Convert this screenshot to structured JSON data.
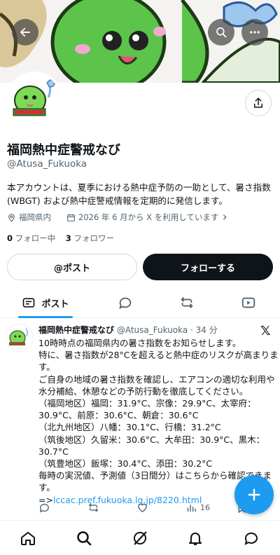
{
  "profile": {
    "name": "福岡熱中症警戒なび",
    "handle": "@Atusa_Fukuoka",
    "bio_line1": "本アカウントは、夏季における熱中症予防の一助として、暑さ指数",
    "bio_line2": "(WBGT) および熱中症警戒情報を定期的に発信します。",
    "location": "福岡県内",
    "joined": "2026 年 6 月から X を利用しています",
    "following_count": "0",
    "following_label": "フォロー中",
    "followers_count": "3",
    "followers_label": "フォロワー"
  },
  "buttons": {
    "post": "@ポスト",
    "follow": "フォローする"
  },
  "tabs": {
    "posts": "ポスト"
  },
  "tweet": {
    "name": "福岡熱中症警戒なび",
    "handle": "@Atusa_Fukuoka · 34 分",
    "lines": [
      "10時時点の福岡県内の暑さ指数をお知らせします。",
      "特に、暑さ指数が28°Cを超えると熱中症のリスクが高まりま",
      "す。",
      "ご自身の地域の暑さ指数を確認し、エアコンの適切な利用や",
      "水分補給、休憩などの予防行動を徹底してください。",
      "（福岡地区）福岡：31.9°C、宗像：29.9°C、太宰府：",
      "30.9°C、前原：30.6°C、朝倉：30.6°C",
      "（北九州地区）八幡：30.1°C、行橋：31.2°C",
      "（筑後地区）久留米：30.6°C、大牟田：30.9°C、黒木：",
      "30.7°C",
      "（筑豊地区）飯塚：30.4°C、添田：30.2°C",
      "毎時の実況値、予測値（3日間分）はこちらから確認できま",
      "す。"
    ],
    "link_prefix": "=>",
    "link": "lccac.pref.fukuoka.lg.jp/8220.html",
    "views": "16"
  },
  "icons": {
    "back": "back-arrow-icon",
    "search": "search-icon",
    "more": "more-icon",
    "share": "share-icon",
    "location": "location-icon",
    "calendar": "calendar-icon"
  },
  "colors": {
    "accent": "#1d9bf0",
    "text": "#0f1419",
    "muted": "#536471",
    "follow_bg": "#0f1419"
  }
}
